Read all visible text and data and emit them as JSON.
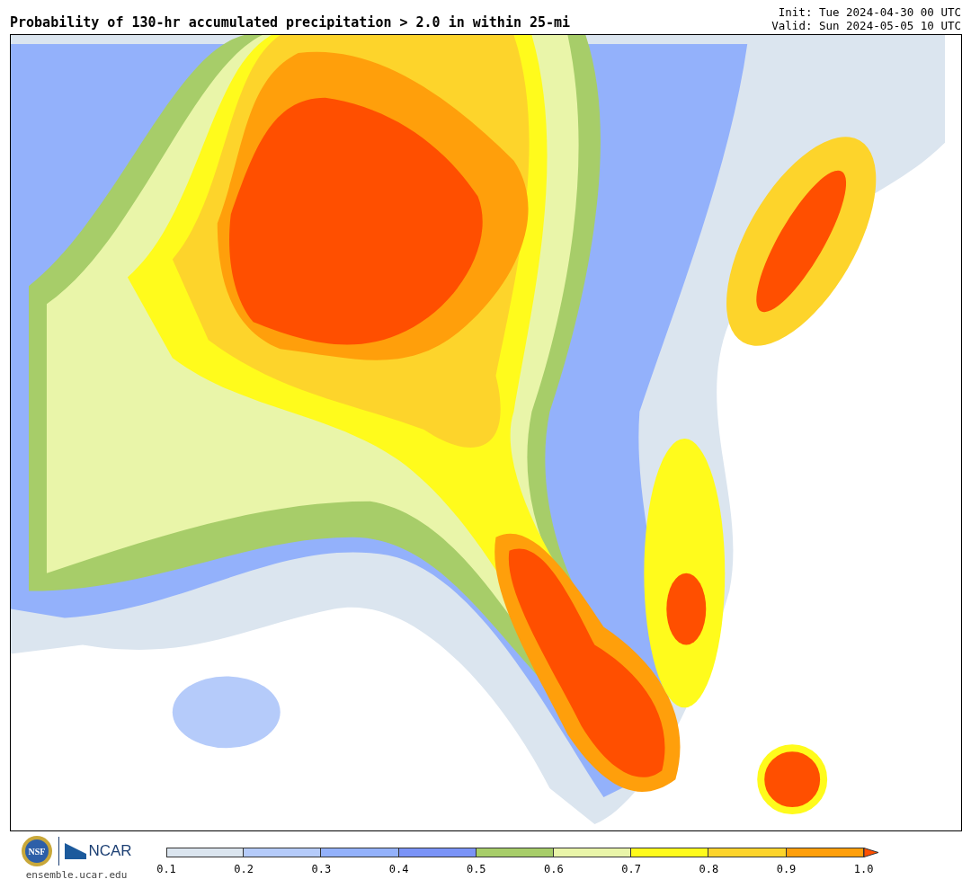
{
  "title": "Probability of 130-hr accumulated precipitation > 2.0 in within 25-mi",
  "init": "Init: Tue 2024-04-30 00 UTC",
  "valid": "Valid: Sun 2024-05-05 10 UTC",
  "logos": {
    "seal_text": "NSF",
    "wordmark": "NCAR",
    "url": "ensemble.ucar.edu"
  },
  "colorbar": {
    "bins": [
      {
        "color": "#dbe5ef"
      },
      {
        "color": "#b5cbfa"
      },
      {
        "color": "#93b1fb"
      },
      {
        "color": "#7a93f7"
      },
      {
        "color": "#a7cd69"
      },
      {
        "color": "#e9f5a9"
      },
      {
        "color": "#fffb1c"
      },
      {
        "color": "#fdd42b"
      },
      {
        "color": "#ff9f0b"
      }
    ],
    "overflow": {
      "color": "#ff4f00"
    },
    "ticks": [
      "0.1",
      "0.2",
      "0.3",
      "0.4",
      "0.5",
      "0.6",
      "0.7",
      "0.8",
      "0.9",
      "1.0"
    ]
  }
}
